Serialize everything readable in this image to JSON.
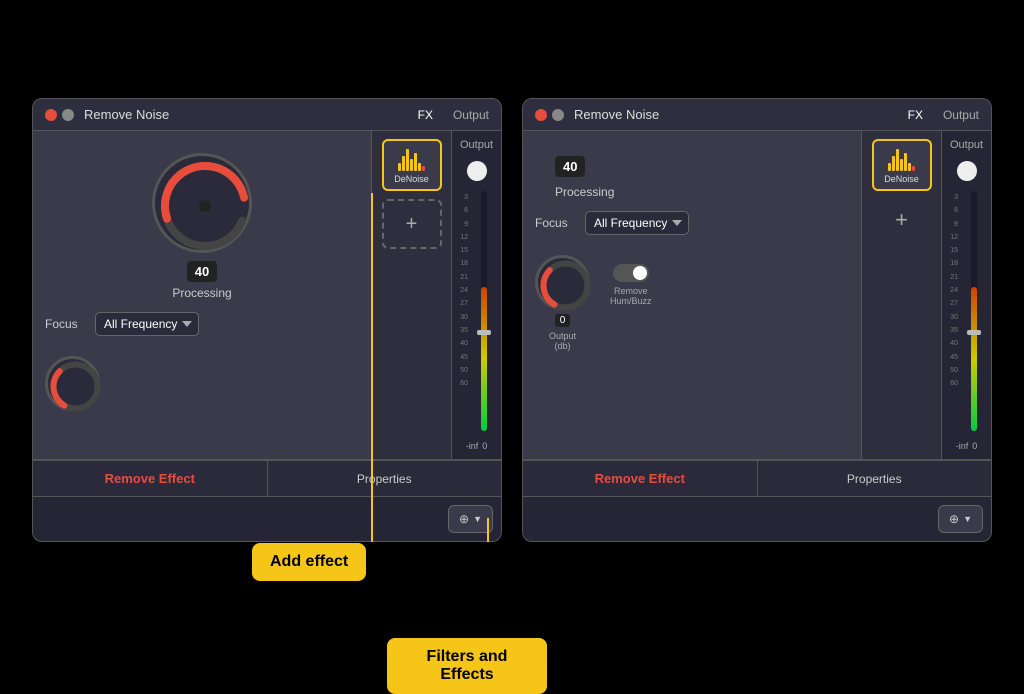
{
  "panels": [
    {
      "id": "panel-left",
      "title": "Remove Noise",
      "tabs": [
        "FX",
        "Output"
      ],
      "traffic_lights": [
        "red",
        "gray"
      ],
      "processing_value": "40",
      "processing_label": "Processing",
      "focus_label": "Focus",
      "focus_options": [
        "All Frequency"
      ],
      "fx_plugin": {
        "label": "DeNoise",
        "has_dashed_add": true
      },
      "remove_effect_label": "Remove Effect",
      "properties_label": "Properties",
      "filter_icon": "⊕",
      "knob_small_value": null,
      "show_bottom_controls": false,
      "show_plus_box": true
    },
    {
      "id": "panel-right",
      "title": "Remove Noise",
      "tabs": [
        "FX",
        "Output"
      ],
      "traffic_lights": [
        "red",
        "gray"
      ],
      "processing_value": "40",
      "processing_label": "Processing",
      "focus_label": "Focus",
      "focus_options": [
        "All Frequency"
      ],
      "fx_plugin": {
        "label": "DeNoise",
        "has_dashed_add": false
      },
      "remove_effect_label": "Remove Effect",
      "properties_label": "Properties",
      "filter_icon": "⊕",
      "output_label": "Output\n(db)",
      "remove_hum_label": "Remove\nHum/Buzz",
      "small_knob_value": "0",
      "show_bottom_controls": true,
      "show_plus_box": false
    }
  ],
  "tooltips": [
    {
      "id": "add-effect-tooltip",
      "text": "Add effect"
    },
    {
      "id": "filters-effects-tooltip",
      "text": "Filters and Effects"
    }
  ],
  "meter_scale": [
    "3",
    "6",
    "9",
    "12",
    "15",
    "18",
    "21",
    "24",
    "27",
    "30",
    "35",
    "40",
    "45",
    "50",
    "60"
  ],
  "inf_label": "-inf",
  "zero_label": "0"
}
